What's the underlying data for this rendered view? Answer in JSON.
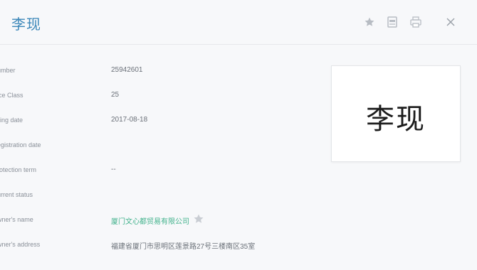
{
  "header": {
    "title": "李现"
  },
  "fields": [
    {
      "label": "Number",
      "value": ""
    },
    {
      "label": "ice Class",
      "value": "25"
    },
    {
      "label": "iling date",
      "value": "2017-08-18"
    },
    {
      "label": "egistration date",
      "value": ""
    },
    {
      "label": "rotection term",
      "value": "--"
    },
    {
      "label": "urrent status",
      "value": ""
    },
    {
      "label": "wner's name",
      "value": "厦门文心都贸易有限公司"
    },
    {
      "label": "wner's address",
      "value": "福建省厦门市思明区莲景路27号三楼南区35室"
    }
  ],
  "number_row": {
    "label": "umber",
    "value": "25942601"
  },
  "mark_image": {
    "text": "李现"
  },
  "colors": {
    "title": "#3a86b8",
    "link": "#42b28c",
    "icon": "#b7bcc3"
  },
  "icons": [
    "star-icon",
    "document-icon",
    "print-icon",
    "close-icon",
    "favorite-star-icon"
  ]
}
